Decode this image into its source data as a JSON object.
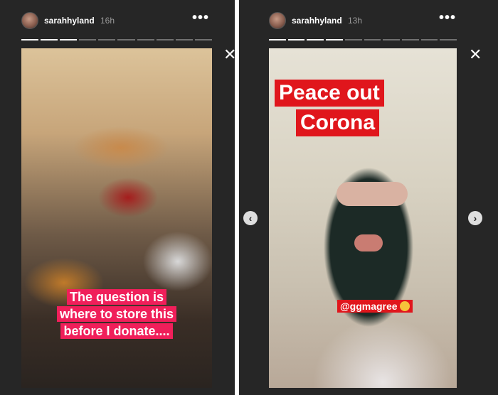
{
  "left_story": {
    "username": "sarahhyland",
    "time": "16h",
    "more_label": "•••",
    "progress": {
      "total": 10,
      "current": 3
    },
    "caption_lines": [
      "The question is",
      "where to store this",
      "before I donate...."
    ]
  },
  "right_story": {
    "username": "sarahhyland",
    "time": "13h",
    "more_label": "•••",
    "progress": {
      "total": 10,
      "current": 4
    },
    "headline_lines": [
      "Peace out",
      "Corona"
    ],
    "mention": "@ggmagree",
    "mention_emoji": "laughing-face-emoji"
  },
  "controls": {
    "close_label": "✕",
    "prev_label": "‹",
    "next_label": "›"
  }
}
